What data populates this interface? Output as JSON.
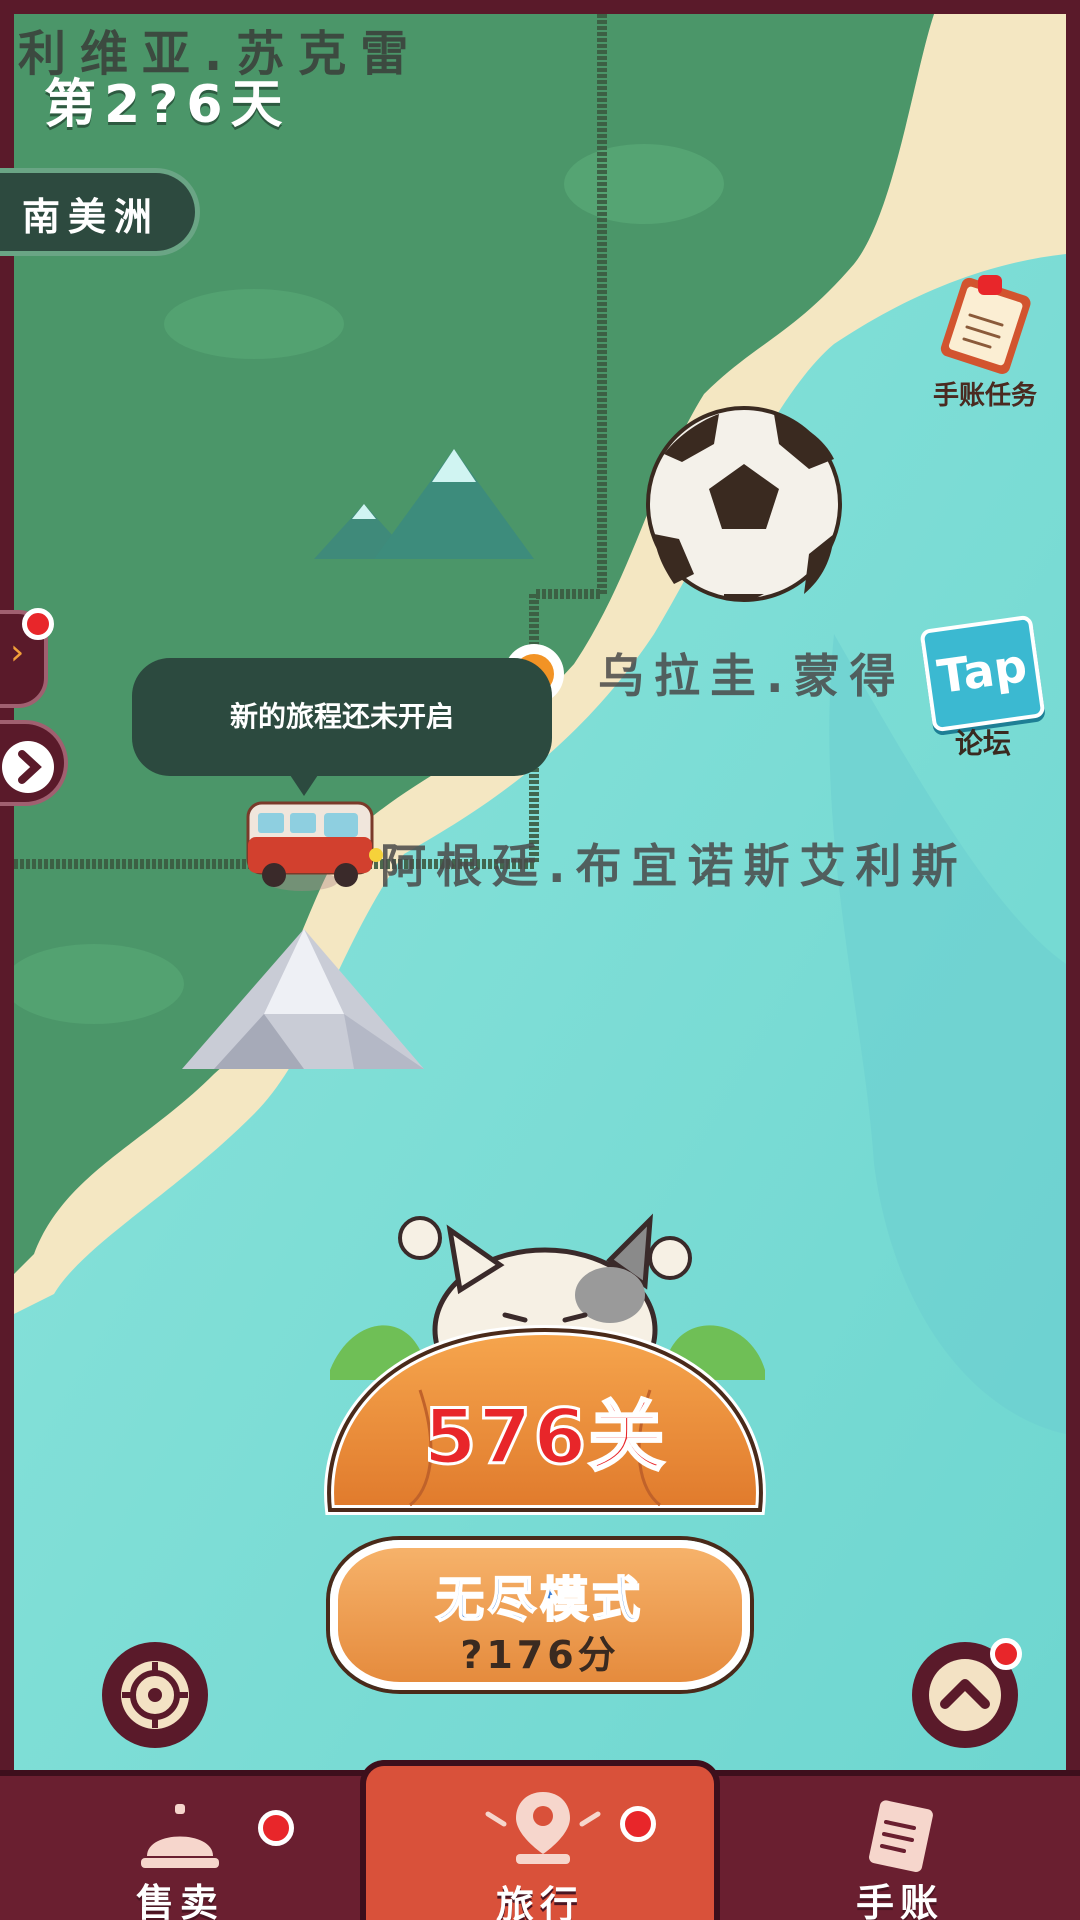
{
  "header": {
    "prev_city": "利维亚.苏克雷",
    "day": "第2?6天"
  },
  "region_badge": "南美洲",
  "cities": {
    "next": "乌拉圭.蒙得",
    "current": "阿根廷.布宜诺斯艾利斯"
  },
  "speech_bubble": "新的旅程还未开启",
  "side_buttons": {
    "journal_task": "手账任务",
    "forum_logo": "Tap",
    "forum": "论坛"
  },
  "level": {
    "label": "576关"
  },
  "endless": {
    "title": "无尽模式",
    "score": "?176分"
  },
  "bottom_nav": [
    {
      "label": "售卖",
      "icon": "service-bell-icon",
      "badge": true
    },
    {
      "label": "旅行",
      "icon": "travel-map-pin-icon",
      "badge": true,
      "active": true
    },
    {
      "label": "手账",
      "icon": "notebook-icon",
      "badge": false
    }
  ],
  "colors": {
    "land": "#4f9a6c",
    "sea": "#7fdcd4",
    "sand": "#f4e7c2",
    "frame": "#5a1a2a",
    "nav": "#6a1f30",
    "nav_active": "#d9513a",
    "level_text": "#e8262a",
    "endless_text": "#3d7fd6"
  }
}
